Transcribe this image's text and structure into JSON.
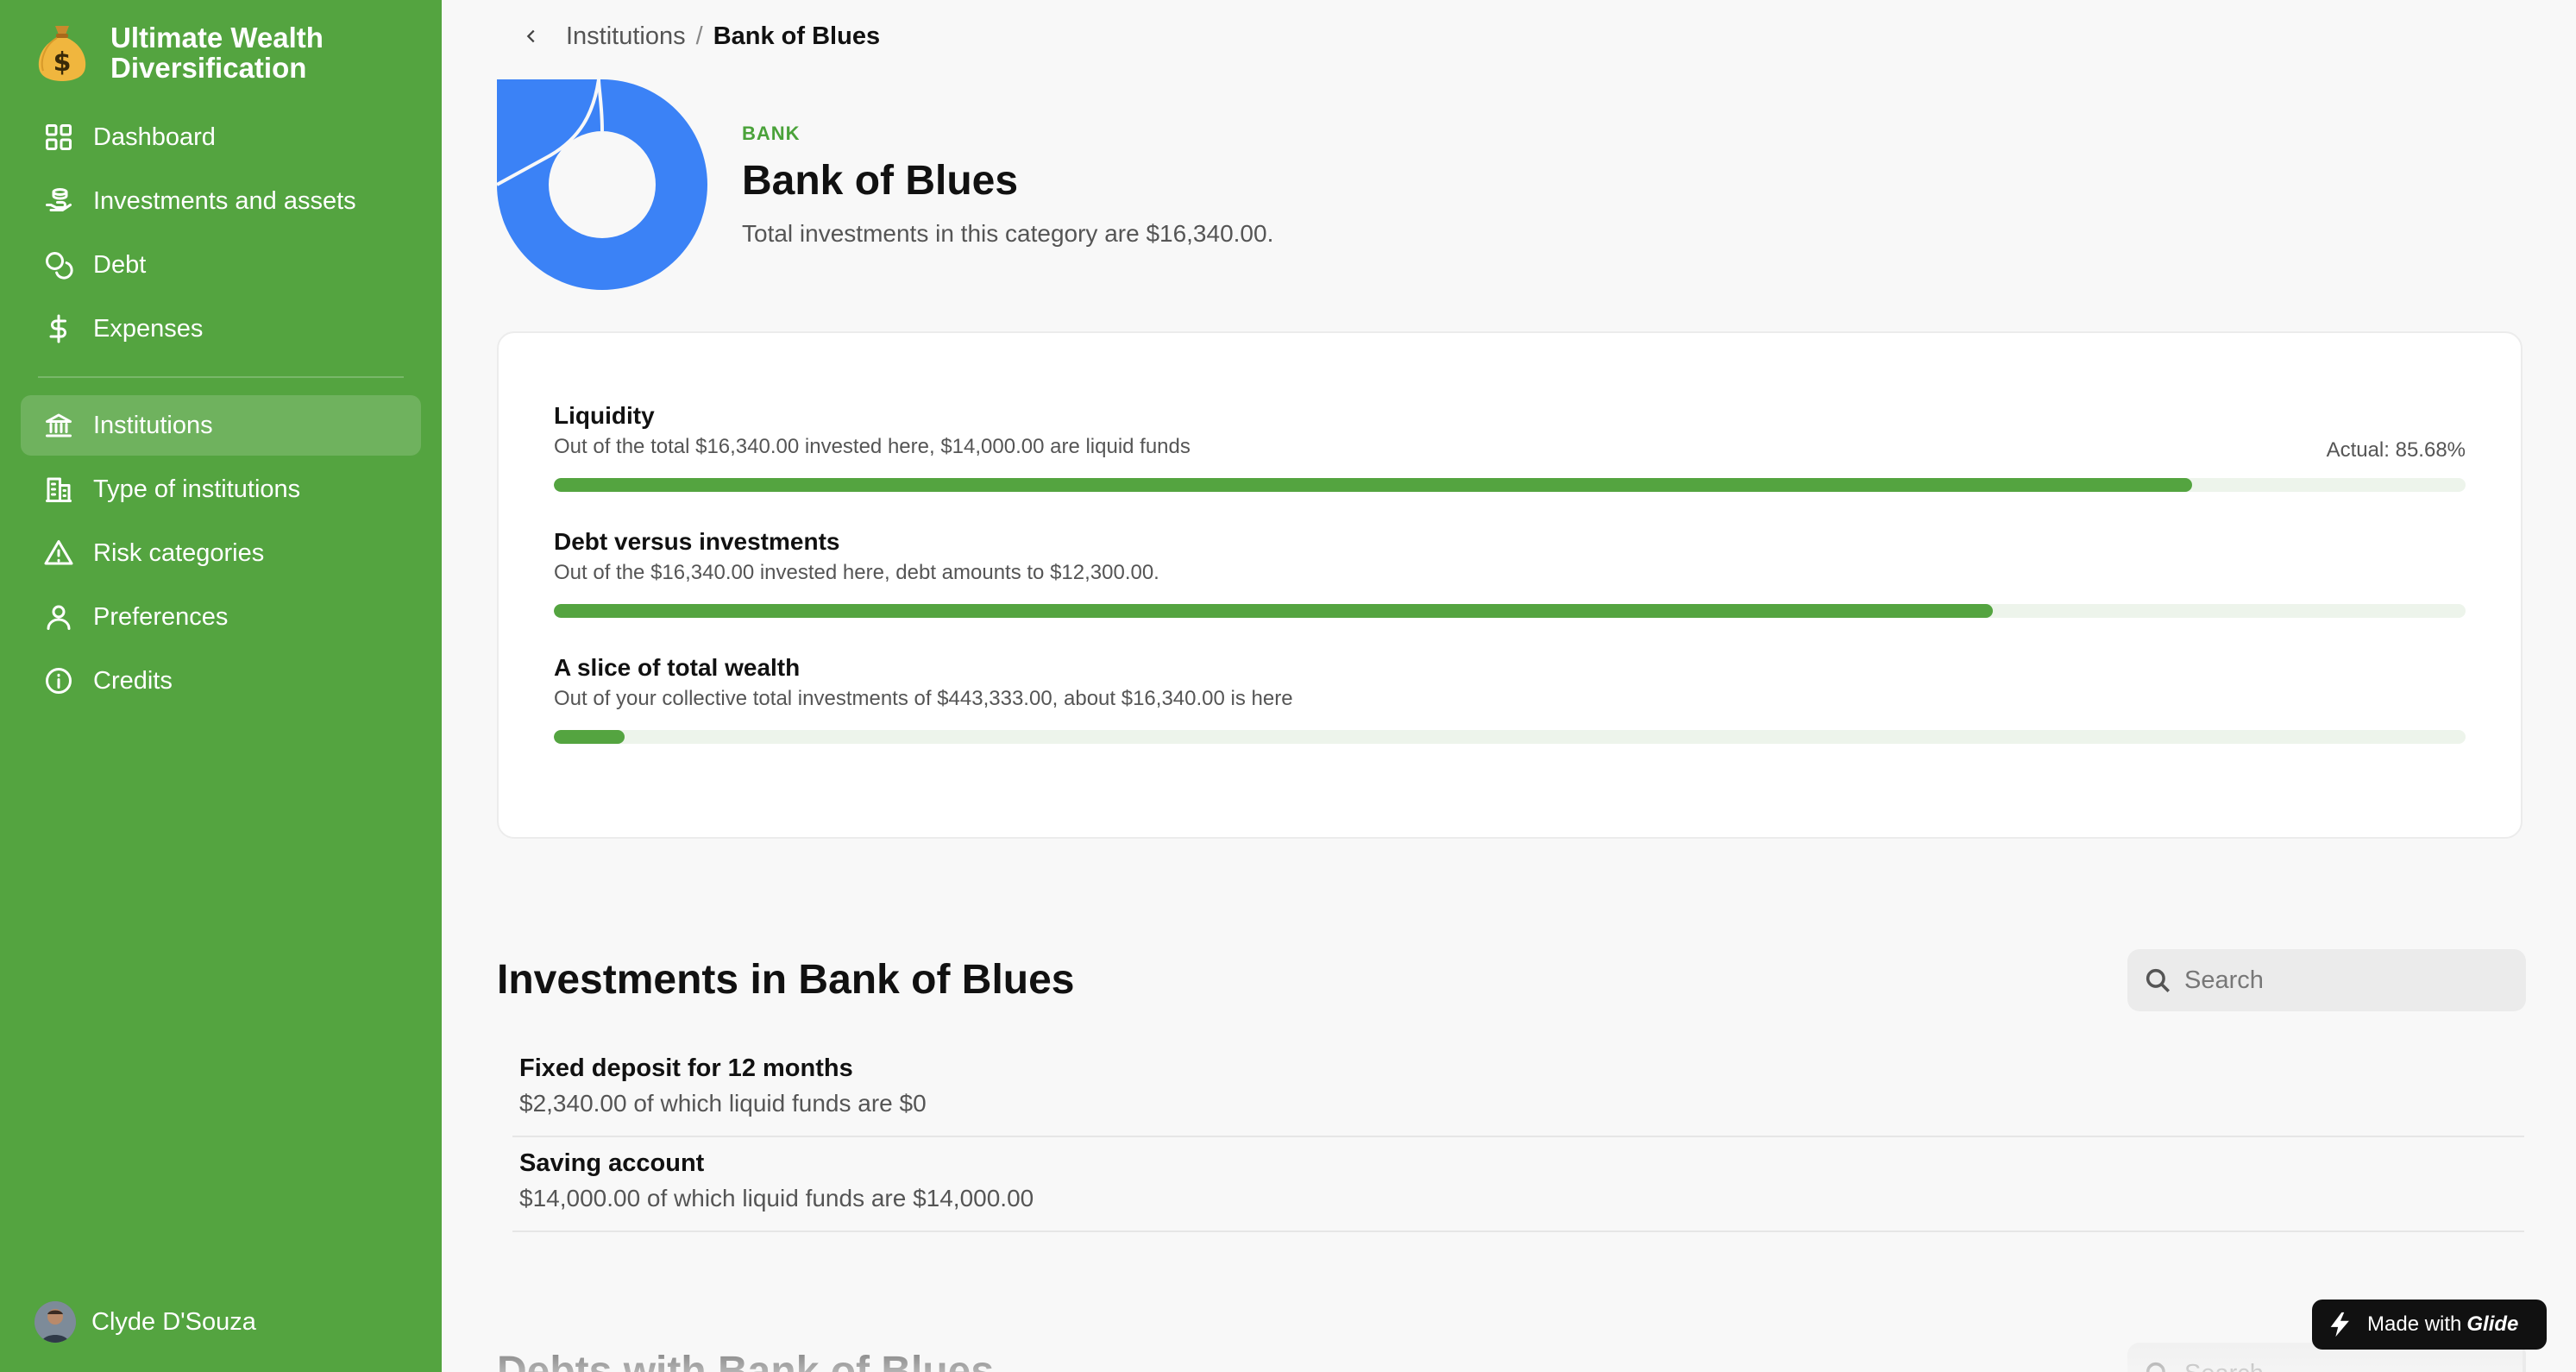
{
  "app": {
    "title": "Ultimate Wealth Diversification",
    "logo_icon": "money-bag-icon"
  },
  "sidebar": {
    "items": [
      {
        "label": "Dashboard",
        "icon": "grid-icon"
      },
      {
        "label": "Investments and assets",
        "icon": "hand-coins-icon"
      },
      {
        "label": "Debt",
        "icon": "coins-icon"
      },
      {
        "label": "Expenses",
        "icon": "dollar-icon"
      },
      {
        "label": "Institutions",
        "icon": "bank-icon",
        "active": true
      },
      {
        "label": "Type of institutions",
        "icon": "building-icon"
      },
      {
        "label": "Risk categories",
        "icon": "warning-icon"
      },
      {
        "label": "Preferences",
        "icon": "user-icon"
      },
      {
        "label": "Credits",
        "icon": "info-icon"
      }
    ],
    "user": {
      "name": "Clyde D'Souza"
    }
  },
  "breadcrumb": {
    "parent": "Institutions",
    "separator": "/",
    "current": "Bank of Blues"
  },
  "institution": {
    "kicker": "BANK",
    "name": "Bank of Blues",
    "summary": "Total investments in this category are $16,340.00.",
    "logo_color": "#3b82f6"
  },
  "metrics": [
    {
      "title": "Liquidity",
      "description": "Out of the total $16,340.00 invested here, $14,000.00 are liquid funds",
      "actual": "Actual: 85.68%",
      "progress": 0.8568
    },
    {
      "title": "Debt versus investments",
      "description": "Out of the $16,340.00 invested here, debt amounts to $12,300.00.",
      "actual": "",
      "progress": 0.7528
    },
    {
      "title": "A slice of total wealth",
      "description": "Out of your collective total investments of $443,333.00, about $16,340.00 is here",
      "actual": "",
      "progress": 0.0369
    }
  ],
  "investments": {
    "title": "Investments in Bank of Blues",
    "search_placeholder": "Search",
    "items": [
      {
        "title": "Fixed deposit for 12 months",
        "subtitle": "$2,340.00 of which liquid funds are $0"
      },
      {
        "title": "Saving account",
        "subtitle": "$14,000.00 of which liquid funds are $14,000.00"
      }
    ]
  },
  "debts": {
    "title": "Debts with Bank of Blues",
    "search_placeholder": "Search"
  },
  "badge": {
    "prefix": "Made with",
    "brand": "Glide"
  },
  "colors": {
    "sidebar": "#54a440",
    "accent": "#54a440",
    "progress_track": "#edf4eb",
    "bank_blue": "#3b82f6"
  }
}
